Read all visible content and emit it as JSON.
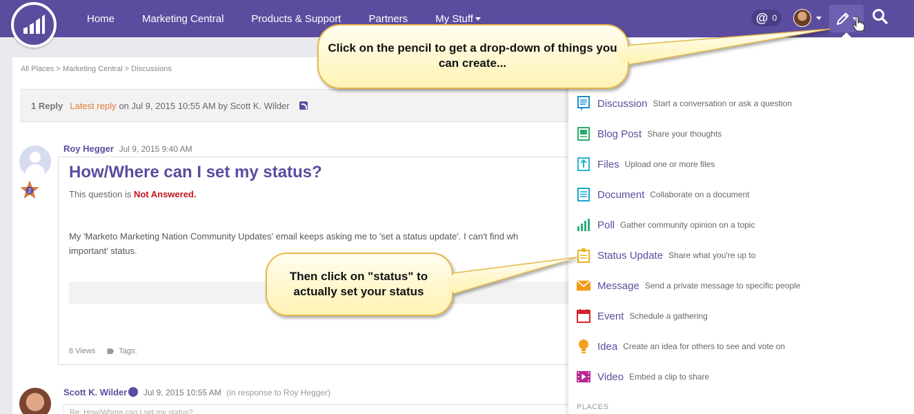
{
  "nav": {
    "items": [
      "Home",
      "Marketing Central",
      "Products & Support",
      "Partners"
    ],
    "my_stuff": "My Stuff",
    "mentions_count": "0"
  },
  "breadcrumb": "All Places > Marketing Central > Discussions",
  "reply_bar": {
    "count": "1 Reply",
    "latest_link": "Latest reply",
    "latest_text": "on Jul 9, 2015 10:55 AM by Scott K. Wilder"
  },
  "post": {
    "author": "Roy Hegger",
    "date": "Jul 9, 2015 9:40 AM",
    "title": "How/Where can I set my status?",
    "status_prefix": "This question is",
    "status_value": "Not Answered.",
    "body_line1": "My 'Marketo Marketing Nation Community Updates' email keeps asking me to 'set a status update'.  I can't find wh",
    "body_line2": "important' status.",
    "views": "8 Views",
    "tags_label": "Tags:",
    "rank": "2"
  },
  "reply": {
    "author": "Scott K. Wilder",
    "date": "Jul 9, 2015 10:55 AM",
    "in_response": "(in response to Roy Hegger)",
    "title": "Re: How/Where can I set my status?"
  },
  "create_menu": {
    "items": [
      {
        "label": "Discussion",
        "desc": "Start a conversation or ask a question",
        "icon": "discussion-icon",
        "color": "#1a8fcf"
      },
      {
        "label": "Blog Post",
        "desc": "Share your thoughts",
        "icon": "blog-icon",
        "color": "#2bab6b"
      },
      {
        "label": "Files",
        "desc": "Upload one or more files",
        "icon": "upload-icon",
        "color": "#26b5c8"
      },
      {
        "label": "Document",
        "desc": "Collaborate on a document",
        "icon": "document-icon",
        "color": "#1aa6cf"
      },
      {
        "label": "Poll",
        "desc": "Gather community opinion on a topic",
        "icon": "poll-icon",
        "color": "#2fae7a"
      },
      {
        "label": "Status Update",
        "desc": "Share what you're up to",
        "icon": "status-icon",
        "color": "#e8b51e"
      },
      {
        "label": "Message",
        "desc": "Send a private message to specific people",
        "icon": "envelope-icon",
        "color": "#f09a1a"
      },
      {
        "label": "Event",
        "desc": "Schedule a gathering",
        "icon": "calendar-icon",
        "color": "#d4232d"
      },
      {
        "label": "Idea",
        "desc": "Create an idea for others to see and vote on",
        "icon": "lightbulb-icon",
        "color": "#f4a11b"
      },
      {
        "label": "Video",
        "desc": "Embed a clip to share",
        "icon": "video-icon",
        "color": "#b5268f"
      }
    ],
    "places_header": "PLACES"
  },
  "callouts": {
    "pencil": "Click on the pencil to get a drop-down of things you can create...",
    "status": "Then click on \"status\" to actually set your status"
  },
  "colors": {
    "brand": "#5c4c9f",
    "accent": "#e07b39",
    "alert": "#c0141c",
    "callout_fill": "#fff8c9"
  }
}
